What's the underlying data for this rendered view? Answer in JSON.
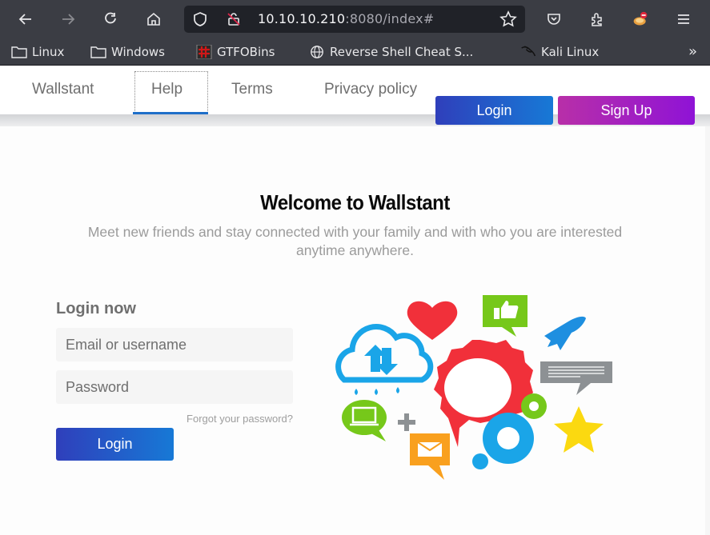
{
  "browser": {
    "url_host": "10.10.10.210",
    "url_rest": ":8080/index#",
    "toolbar_icons": [
      "back-icon",
      "forward-icon",
      "reload-icon",
      "home-icon",
      "shield-icon",
      "insecure-lock-icon",
      "bookmark-star-icon",
      "pocket-icon",
      "extensions-icon",
      "profile-icon",
      "menu-icon"
    ],
    "bookmarks": [
      {
        "label": "Linux",
        "icon": "folder-icon"
      },
      {
        "label": "Windows",
        "icon": "folder-icon"
      },
      {
        "label": "GTFOBins",
        "icon": "gtfobins-icon"
      },
      {
        "label": "Reverse Shell Cheat S...",
        "icon": "globe-icon"
      },
      {
        "label": "Kali Linux",
        "icon": "kali-dragon-icon"
      }
    ],
    "bookmarks_overflow": "»"
  },
  "nav": {
    "links": [
      "Wallstant",
      "Help",
      "Terms",
      "Privacy policy"
    ],
    "active": "Help",
    "login_label": "Login",
    "signup_label": "Sign Up"
  },
  "hero": {
    "title": "Welcome to Wallstant",
    "subtitle": "Meet new friends and stay connected with your family and with who you are interested anytime anywhere."
  },
  "login_form": {
    "title": "Login now",
    "email_placeholder": "Email or username",
    "password_placeholder": "Password",
    "forgot_label": "Forgot your password?",
    "submit_label": "Login"
  },
  "colors": {
    "primary_gradient_start": "#2f3fbb",
    "primary_gradient_end": "#1779d6",
    "signup_gradient_start": "#b82fa8",
    "signup_gradient_end": "#8f13d6",
    "active_underline": "#1e6fc9"
  }
}
